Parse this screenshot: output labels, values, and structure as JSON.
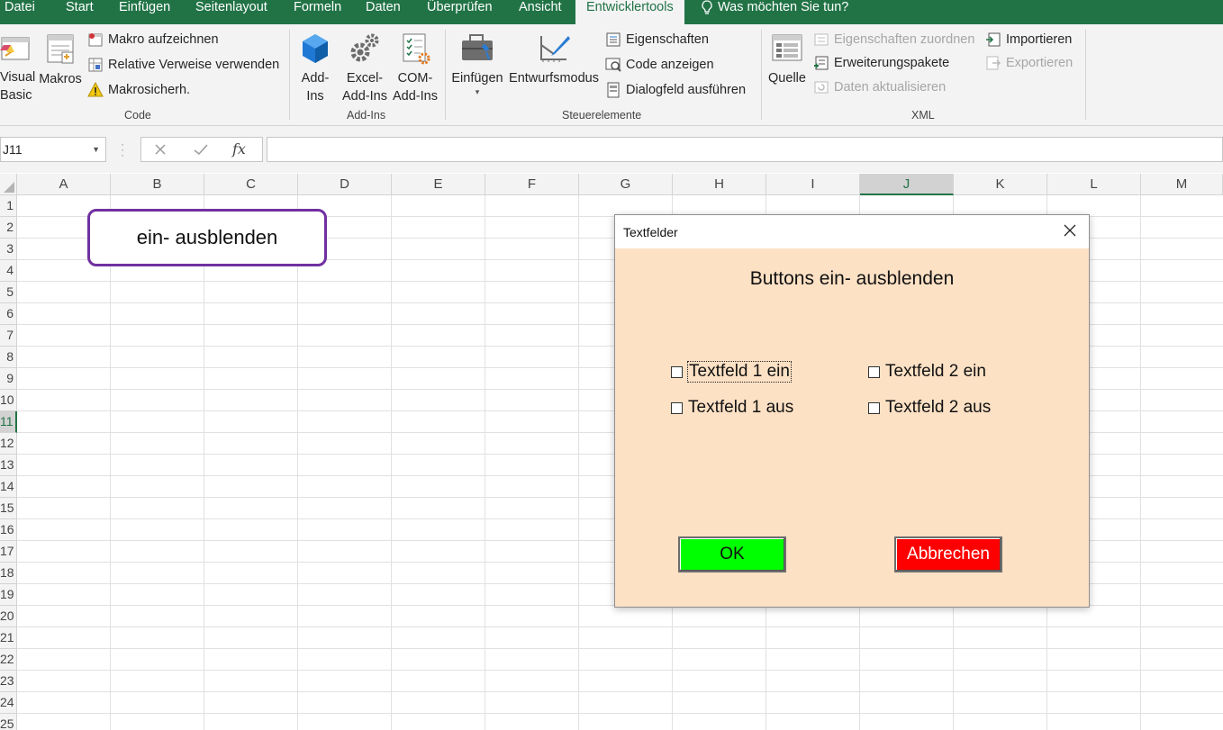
{
  "menu": {
    "tabs": [
      {
        "id": "datei",
        "label": "Datei"
      },
      {
        "id": "start",
        "label": "Start"
      },
      {
        "id": "einfuegen",
        "label": "Einfügen"
      },
      {
        "id": "seitenlayout",
        "label": "Seitenlayout"
      },
      {
        "id": "formeln",
        "label": "Formeln"
      },
      {
        "id": "daten",
        "label": "Daten"
      },
      {
        "id": "ueberpruefen",
        "label": "Überprüfen"
      },
      {
        "id": "ansicht",
        "label": "Ansicht"
      },
      {
        "id": "entwicklertools",
        "label": "Entwicklertools",
        "active": true
      }
    ],
    "tell_me": "Was möchten Sie tun?",
    "tell_me_icon": "lightbulb-icon"
  },
  "ribbon": {
    "code": {
      "label": "Code",
      "visual_basic": "Visual\nBasic",
      "visual_basic_line1": "Visual",
      "visual_basic_line2": "Basic",
      "makros": "Makros",
      "makro_aufzeichnen": "Makro aufzeichnen",
      "relative_verweise": "Relative Verweise verwenden",
      "makrosicherheit": "Makrosicherh."
    },
    "addins": {
      "label": "Add-Ins",
      "addins_line1": "Add-",
      "addins_line2": "Ins",
      "excel_line1": "Excel-",
      "excel_line2": "Add-Ins",
      "com_line1": "COM-",
      "com_line2": "Add-Ins"
    },
    "steuerelemente": {
      "label": "Steuerelemente",
      "einfuegen": "Einfügen",
      "entwurfsmodus": "Entwurfsmodus",
      "eigenschaften": "Eigenschaften",
      "code_anzeigen": "Code anzeigen",
      "dialogfeld": "Dialogfeld ausführen"
    },
    "xml": {
      "label": "XML",
      "quelle": "Quelle",
      "eigenschaften_zuordnen": "Eigenschaften zuordnen",
      "erweiterungspakete": "Erweiterungspakete",
      "daten_aktualisieren": "Daten aktualisieren",
      "importieren": "Importieren",
      "exportieren": "Exportieren"
    }
  },
  "formula_bar": {
    "name_box": "J11",
    "fx": "fx",
    "value": ""
  },
  "sheet": {
    "columns": [
      "A",
      "B",
      "C",
      "D",
      "E",
      "F",
      "G",
      "H",
      "I",
      "J",
      "K",
      "L",
      "M"
    ],
    "selected_column": "J",
    "rows": [
      "1",
      "2",
      "3",
      "4",
      "5",
      "6",
      "7",
      "8",
      "9",
      "10",
      "11",
      "12",
      "13",
      "14",
      "15",
      "16",
      "17",
      "18",
      "19",
      "20",
      "21",
      "22",
      "23",
      "24",
      "25"
    ],
    "selected_row": "11",
    "shape_text": "ein- ausblenden",
    "shape_border_color": "#7030a0"
  },
  "dialog": {
    "title": "Textfelder",
    "heading": "Buttons ein- ausblenden",
    "background": "#fde1c5",
    "checkboxes": {
      "tf1_ein": "Textfeld 1 ein",
      "tf2_ein": "Textfeld 2 ein",
      "tf1_aus": "Textfeld 1 aus",
      "tf2_aus": "Textfeld 2 aus"
    },
    "ok_label": "OK",
    "ok_color": "#00ff00",
    "cancel_label": "Abbrechen",
    "cancel_color": "#ff0000"
  }
}
